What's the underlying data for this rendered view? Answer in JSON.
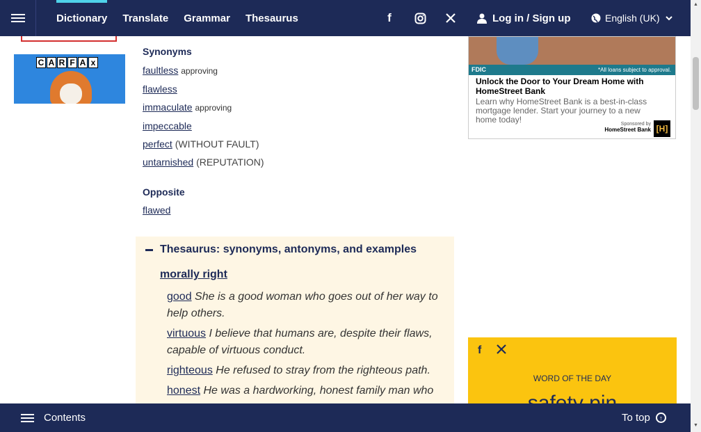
{
  "header": {
    "nav": [
      "Dictionary",
      "Translate",
      "Grammar",
      "Thesaurus"
    ],
    "social_icons": [
      "facebook-icon",
      "instagram-icon",
      "x-icon"
    ],
    "login_label": "Log in / Sign up",
    "language_label": "English (UK)"
  },
  "left_ad": {
    "brand_letters": [
      "C",
      "A",
      "R",
      "F",
      "A",
      "x"
    ]
  },
  "synonyms": {
    "heading": "Synonyms",
    "items": [
      {
        "word": "faultless",
        "tag": "approving"
      },
      {
        "word": "flawless",
        "tag": ""
      },
      {
        "word": "immaculate",
        "tag": "approving"
      },
      {
        "word": "impeccable",
        "tag": ""
      },
      {
        "word": "perfect",
        "tag": "(WITHOUT FAULT)"
      },
      {
        "word": "untarnished",
        "tag": "(REPUTATION)"
      }
    ]
  },
  "opposite": {
    "heading": "Opposite",
    "items": [
      "flawed"
    ]
  },
  "thesaurus": {
    "heading": "Thesaurus: synonyms, antonyms, and examples",
    "sense": "morally right",
    "examples": [
      {
        "word": "good",
        "sentence": "She is a good woman who goes out of her way to help others."
      },
      {
        "word": "virtuous",
        "sentence": "I believe that humans are, despite their flaws, capable of virtuous conduct."
      },
      {
        "word": "righteous",
        "sentence": "He refused to stray from the righteous path."
      },
      {
        "word": "honest",
        "sentence": "He was a hardworking, honest family man who"
      }
    ]
  },
  "right_ad": {
    "fdic": "FDIC",
    "note": "*All loans subject to approval.",
    "title": "Unlock the Door to Your Dream Home with HomeStreet Bank",
    "body": "Learn why HomeStreet Bank is a best-in-class mortgage lender. Start your journey to a new home today!",
    "sponsored": "Sponsored by",
    "sponsor": "HomeStreet Bank",
    "logo": "[H]"
  },
  "wotd": {
    "label": "WORD OF THE DAY",
    "word": "safety pin"
  },
  "footer": {
    "contents_label": "Contents",
    "top_label": "To top"
  }
}
